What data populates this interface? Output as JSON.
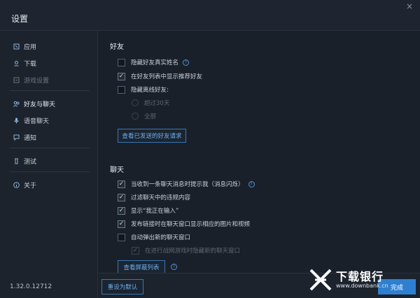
{
  "window": {
    "title": "设置",
    "close_icon": "×"
  },
  "sidebar": {
    "items": [
      {
        "label": "应用",
        "icon": "app-icon"
      },
      {
        "label": "下载",
        "icon": "download-icon"
      },
      {
        "label": "游戏设置",
        "icon": "game-settings-icon",
        "disabled": true
      },
      {
        "label": "好友与聊天",
        "icon": "friends-icon",
        "active": true
      },
      {
        "label": "语音聊天",
        "icon": "mic-icon"
      },
      {
        "label": "通知",
        "icon": "notification-icon"
      },
      {
        "label": "测试",
        "icon": "test-icon"
      },
      {
        "label": "关于",
        "icon": "about-icon"
      }
    ],
    "version": "1.32.0.12712"
  },
  "friends": {
    "title": "好友",
    "hide_real_name": {
      "label": "隐藏好友真实姓名",
      "checked": false
    },
    "show_recommended": {
      "label": "在好友列表中显示推荐好友",
      "checked": true
    },
    "hide_offline": {
      "label": "隐藏离线好友:",
      "checked": false
    },
    "offline_options": [
      "超过30天",
      "全部"
    ],
    "view_requests_button": "查看已发送的好友请求"
  },
  "chat": {
    "title": "聊天",
    "options": [
      {
        "label": "当收到一条聊天消息时提示我（消息闪烁）",
        "checked": true,
        "help": true
      },
      {
        "label": "过滤聊天中的违规内容",
        "checked": true
      },
      {
        "label": "显示“我正在输入”",
        "checked": true
      },
      {
        "label": "发布链接时在聊天窗口显示相应的图片和视频",
        "checked": true
      },
      {
        "label": "自动弹出新的聊天窗口",
        "checked": false
      }
    ],
    "sub_option": {
      "label": "在进行战网游戏时隐藏新的聊天窗口",
      "checked": true,
      "disabled": true
    },
    "block_list_button": "查看屏蔽列表"
  },
  "footer": {
    "reset_button": "重设为默认",
    "done_button": "完成"
  },
  "watermark": {
    "brand": "下载银行",
    "url": "www.downbank.cn"
  },
  "colors": {
    "accent": "#2f7fd0",
    "link": "#6eb0ee",
    "background": "#1a2029"
  }
}
